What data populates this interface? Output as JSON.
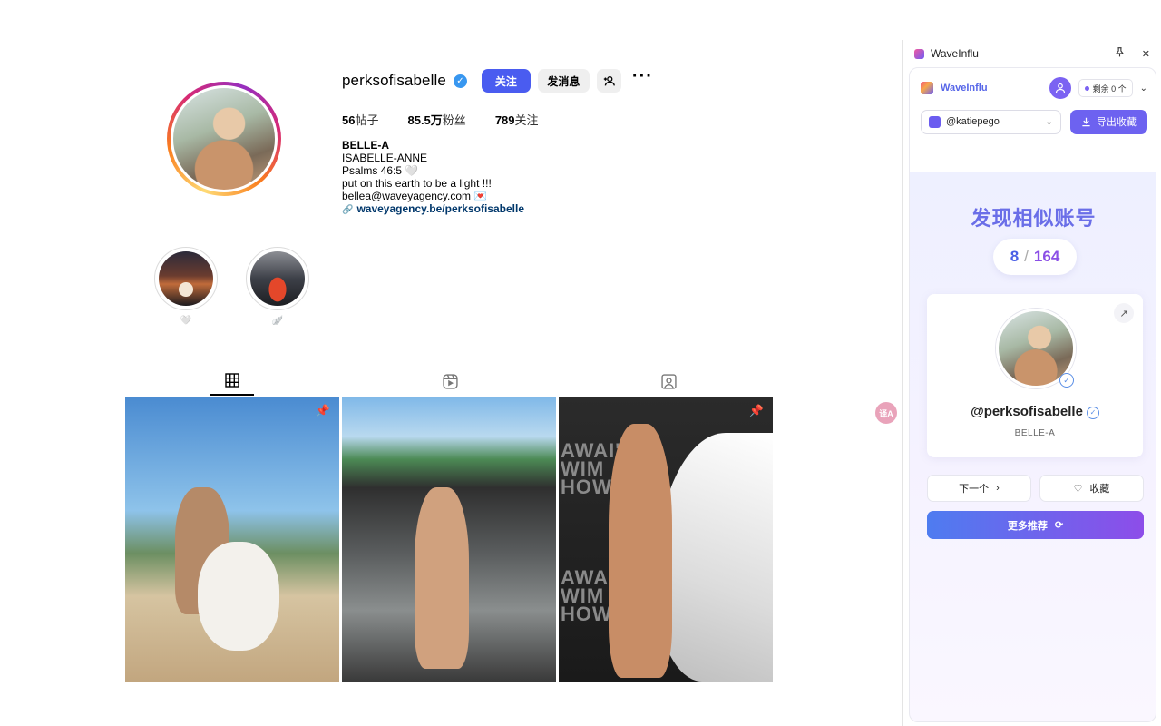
{
  "profile": {
    "username": "perksofisabelle",
    "follow_label": "关注",
    "message_label": "发消息",
    "add_user_icon": "add-user-icon",
    "more_icon": "more-dots-icon",
    "stats": [
      {
        "value": "56",
        "label": "帖子"
      },
      {
        "value": "85.5万",
        "label": "粉丝"
      },
      {
        "value": "789",
        "label": "关注"
      }
    ],
    "bio": {
      "name": "BELLE-A",
      "line1": "ISABELLE-ANNE",
      "line2": "Psalms 46:5 🤍",
      "line3": "put on this earth to be a light !!!",
      "line4": "bellea@waveyagency.com 💌",
      "link": "waveyagency.be/perksofisabelle"
    }
  },
  "highlights": [
    {
      "label": "🤍"
    },
    {
      "label": "🪽"
    }
  ],
  "tabs": [
    {
      "name": "posts-grid",
      "icon": "grid-icon",
      "active": true
    },
    {
      "name": "reels",
      "icon": "reels-icon",
      "active": false
    },
    {
      "name": "tagged",
      "icon": "tagged-icon",
      "active": false
    }
  ],
  "posts": [
    {
      "pinned": true,
      "overlay_text": ""
    },
    {
      "pinned": true,
      "overlay_text": ""
    },
    {
      "pinned": true,
      "overlay_text": "AWAI'I\nWIM\nHOW"
    }
  ],
  "float_button": {
    "label": "译A"
  },
  "panel": {
    "title": "WaveInflu",
    "brand_name": "WaveInflu",
    "quota": "剩余 0 个",
    "account": "@katiepego",
    "export_label": "导出收藏",
    "discover_title": "发现相似账号",
    "counter": {
      "current": "8",
      "separator": "/",
      "total": "164"
    },
    "card": {
      "username": "@perksofisabelle",
      "full_name": "BELLE-A"
    },
    "next_label": "下一个",
    "favorite_label": "收藏",
    "more_label": "更多推荐",
    "colors": {
      "accent": "#6d62f0",
      "gradient_start": "#4e7cf0",
      "gradient_end": "#8d4de9",
      "follow": "#4a5cf0"
    }
  }
}
